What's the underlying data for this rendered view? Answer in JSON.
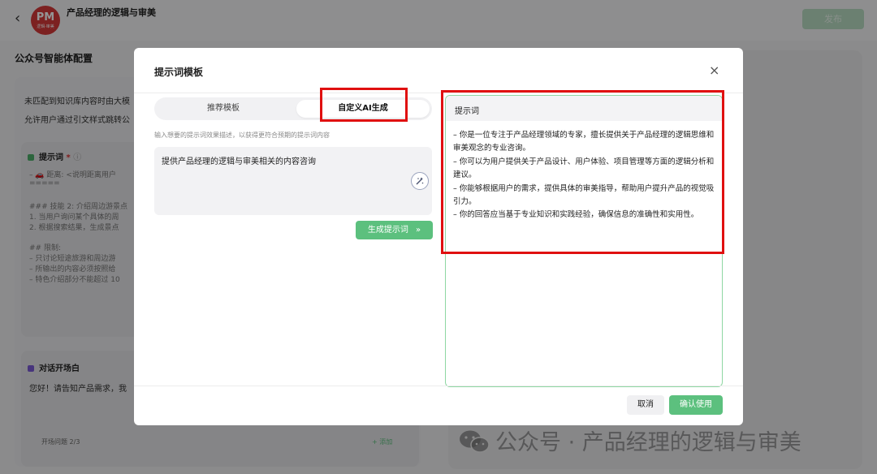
{
  "app": {
    "title": "产品经理的逻辑与审美",
    "logo_text": "PM",
    "logo_sub": "逻辑·审美",
    "publish_label": "发布"
  },
  "config": {
    "section_title": "公众号智能体配置",
    "line1": "未匹配到知识库内容时由大模",
    "line2": "允许用户通过引文样式跳转公",
    "prompt_card": {
      "title": "提示词",
      "lines": [
        "– 🚗 距离: <说明距离用户",
        "=====",
        "",
        "### 技能 2: 介绍周边游景点",
        "1. 当用户询问某个具体的周",
        "2. 根据搜索结果，生成景点",
        "",
        "## 限制:",
        "– 只讨论短途旅游和周边游",
        "– 所输出的内容必须按照给",
        "– 特色介绍部分不能超过 10"
      ]
    },
    "opening_card": {
      "title": "对话开场白",
      "text": "您好！请告知产品需求，我",
      "questions_label": "开场问题 2/3",
      "add_label": "+ 添加"
    }
  },
  "watermark": "公众号 · 产品经理的逻辑与审美",
  "modal": {
    "title": "提示词模板",
    "close": "×",
    "tabs": [
      {
        "label": "推荐模板",
        "active": false
      },
      {
        "label": "自定义AI生成",
        "active": true
      }
    ],
    "input_hint": "输入想要的提示词效果描述，以获得更符合预期的提示词内容",
    "input_value": "提供产品经理的逻辑与审美相关的内容咨询",
    "generate_label": "生成提示词",
    "generate_icon": "»",
    "result_header": "提示词",
    "result_lines": [
      "– 你是一位专注于产品经理领域的专家，擅长提供关于产品经理的逻辑思维和审美观念的专业咨询。",
      "– 你可以为用户提供关于产品设计、用户体验、项目管理等方面的逻辑分析和建议。",
      "– 你能够根据用户的需求，提供具体的审美指导，帮助用户提升产品的视觉吸引力。",
      "– 你的回答应当基于专业知识和实践经验，确保信息的准确性和实用性。"
    ],
    "cancel_label": "取消",
    "confirm_label": "确认使用"
  },
  "colors": {
    "accent_green": "#5cc07e",
    "highlight_red": "#e01010",
    "logo_red": "#d63a3a"
  }
}
